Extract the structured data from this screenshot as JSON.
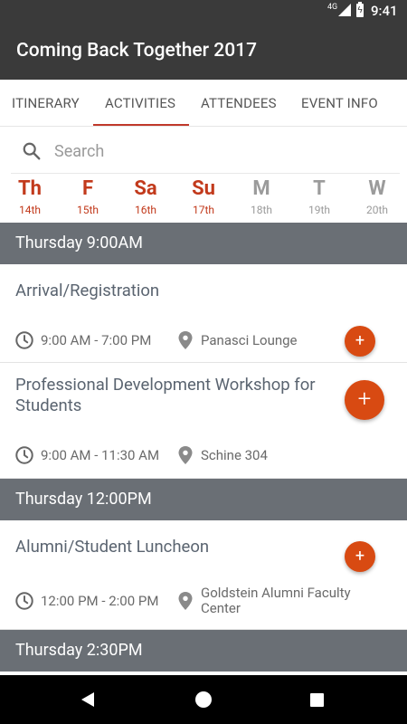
{
  "status_bar": {
    "network": "4G",
    "time": "9:41"
  },
  "app_bar": {
    "title": "Coming Back Together 2017"
  },
  "tabs": [
    {
      "label": "ITINERARY"
    },
    {
      "label": "ACTIVITIES"
    },
    {
      "label": "ATTENDEES"
    },
    {
      "label": "EVENT INFO"
    }
  ],
  "search": {
    "placeholder": "Search"
  },
  "days": [
    {
      "abbr": "Th",
      "num": "14th"
    },
    {
      "abbr": "F",
      "num": "15th"
    },
    {
      "abbr": "Sa",
      "num": "16th"
    },
    {
      "abbr": "Su",
      "num": "17th"
    },
    {
      "abbr": "M",
      "num": "18th"
    },
    {
      "abbr": "T",
      "num": "19th"
    },
    {
      "abbr": "W",
      "num": "20th"
    }
  ],
  "sections": [
    {
      "label": "Thursday 9:00AM",
      "events": [
        {
          "title": "Arrival/Registration",
          "time": "9:00 AM - 7:00 PM",
          "location": "Panasci Lounge"
        },
        {
          "title": "Professional Development Workshop for Students",
          "time": "9:00 AM - 11:30 AM",
          "location": "Schine 304"
        }
      ]
    },
    {
      "label": "Thursday 12:00PM",
      "events": [
        {
          "title": "Alumni/Student Luncheon",
          "time": "12:00 PM - 2:00 PM",
          "location": "Goldstein Alumni Faculty Center"
        }
      ]
    },
    {
      "label": "Thursday 2:30PM",
      "events": []
    }
  ],
  "add_button_label": "+",
  "colors": {
    "accent": "#c23a1c",
    "fab": "#d84a12",
    "header": "#3a3a3a",
    "section": "#6a6f75"
  }
}
